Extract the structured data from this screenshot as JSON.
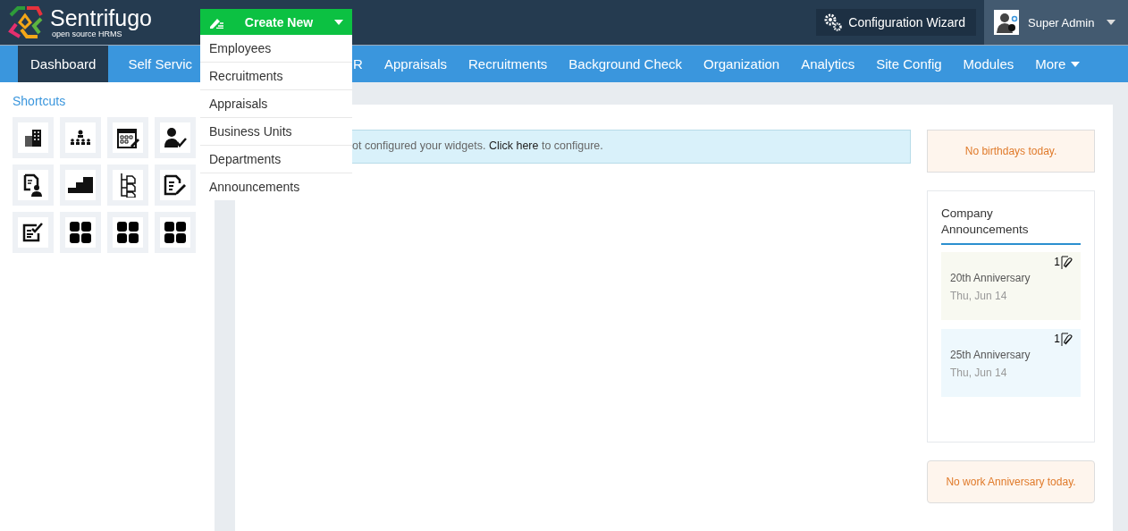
{
  "header": {
    "logo_title": "Sentrifugo",
    "logo_subtitle": "open source HRMS",
    "create_button": "Create New",
    "config_button": "Configuration Wizard",
    "user_name": "Super Admin"
  },
  "create_menu": [
    "Employees",
    "Recruitments",
    "Appraisals",
    "Business Units",
    "Departments",
    "Announcements"
  ],
  "nav": {
    "left_items": [
      {
        "label": "Dashboard",
        "selected": true
      },
      {
        "label": "Self Servic",
        "selected": false
      }
    ],
    "right_items": [
      {
        "label": "R",
        "selected": false
      },
      {
        "label": "Appraisals",
        "selected": false
      },
      {
        "label": "Recruitments",
        "selected": false
      },
      {
        "label": "Background Check",
        "selected": false
      },
      {
        "label": "Organization",
        "selected": false
      },
      {
        "label": "Analytics",
        "selected": false
      },
      {
        "label": "Site Config",
        "selected": false
      },
      {
        "label": "Modules",
        "selected": false
      }
    ],
    "more": "More"
  },
  "shortcuts": {
    "title": "Shortcuts",
    "items": [
      {
        "kind": "building"
      },
      {
        "kind": "team"
      },
      {
        "kind": "calendar"
      },
      {
        "kind": "approve"
      },
      {
        "kind": "profile"
      },
      {
        "kind": "steps"
      },
      {
        "kind": "tree"
      },
      {
        "kind": "edit"
      },
      {
        "kind": "checklist"
      },
      {
        "kind": "grid"
      },
      {
        "kind": "grid"
      },
      {
        "kind": "grid"
      }
    ]
  },
  "alert": {
    "before": "ot configured your widgets. ",
    "link": "Click here",
    "after": " to configure."
  },
  "birthdays": "No birthdays today.",
  "announcements": {
    "title": "Company Announcements",
    "items": [
      {
        "title": "20th Anniversary",
        "date": "Thu, Jun 14",
        "attachments": "1",
        "color": "#f8f9f1"
      },
      {
        "title": "25th Anniversary",
        "date": "Thu, Jun 14",
        "attachments": "1",
        "color": "#eef8fd"
      }
    ]
  },
  "anniversaries": "No work Anniversary today."
}
